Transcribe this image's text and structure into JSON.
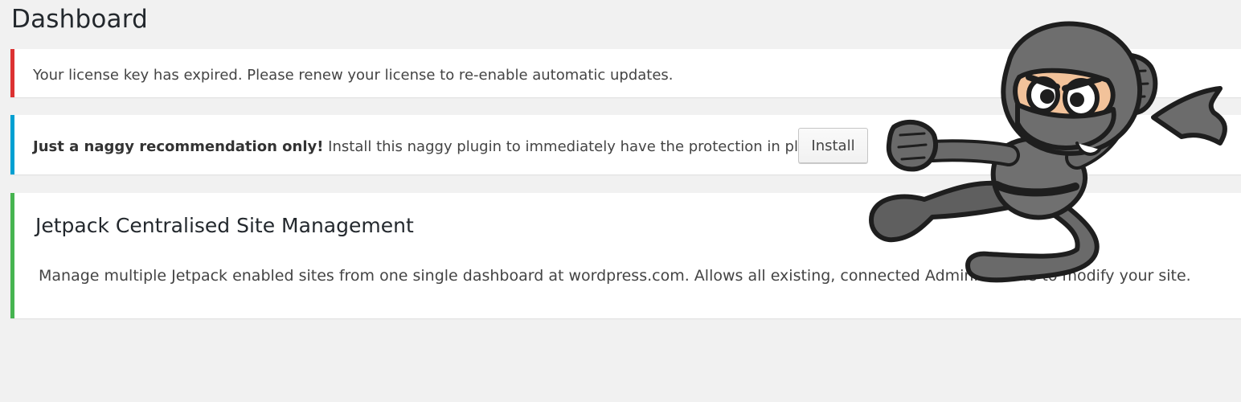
{
  "page": {
    "title": "Dashboard"
  },
  "notices": {
    "error": {
      "text": "Your license key has expired. Please renew your license to re-enable automatic updates.",
      "color": "#dc3232"
    },
    "info": {
      "bold_text": "Just a naggy recommendation only!",
      "text": " Install this naggy plugin to immediately have the protection in place.",
      "install_label": "Install",
      "color": "#00a0d2"
    },
    "success": {
      "title": "Jetpack Centralised Site Management",
      "description": "Manage multiple Jetpack enabled sites from one single dashboard at wordpress.com. Allows all existing, connected Administrators to modify your site.",
      "color": "#46b450"
    }
  },
  "illustration": {
    "icon": "ninja-mascot-icon"
  }
}
